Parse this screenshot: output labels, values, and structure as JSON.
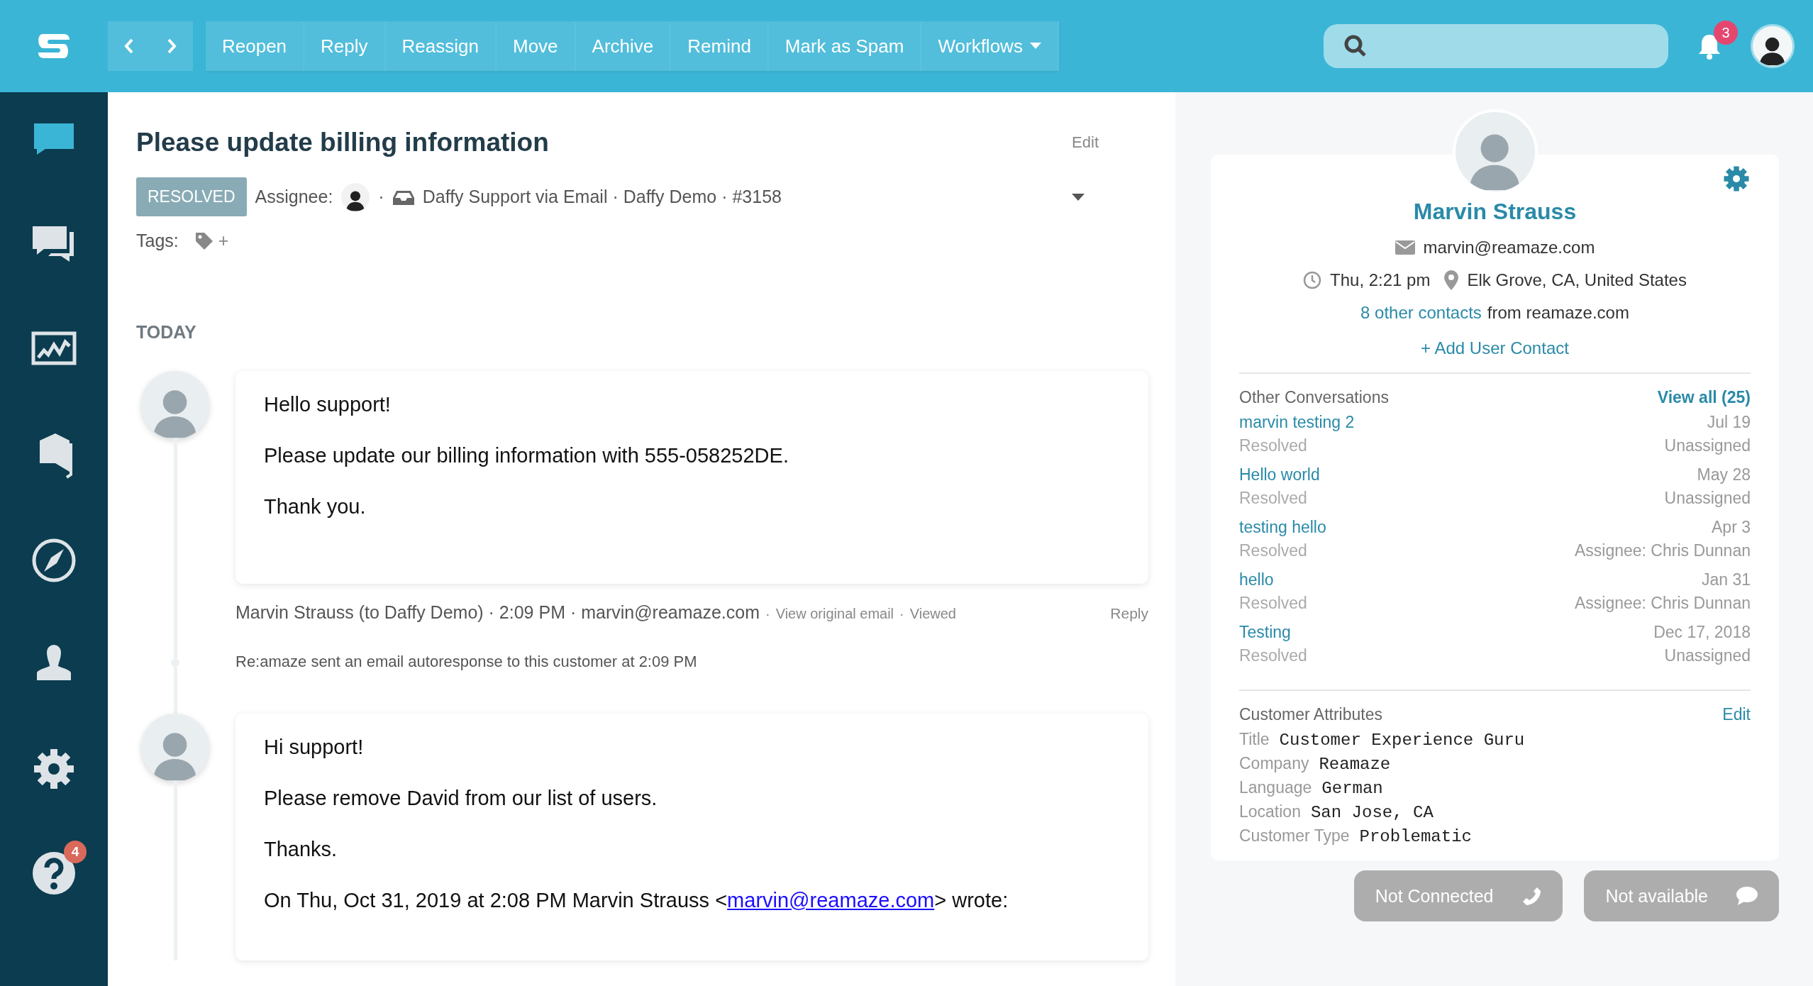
{
  "topbar": {
    "actions": [
      {
        "label": "Reopen",
        "kind": "button"
      },
      {
        "label": "Reply",
        "kind": "button"
      },
      {
        "label": "Reassign",
        "kind": "button"
      },
      {
        "label": "Move",
        "kind": "button"
      },
      {
        "label": "Archive",
        "kind": "button"
      },
      {
        "label": "Remind",
        "kind": "button"
      },
      {
        "label": "Mark as Spam",
        "kind": "button"
      },
      {
        "label": "Workflows",
        "kind": "dropdown"
      }
    ],
    "notification_count": "3"
  },
  "sidebar": {
    "items": [
      {
        "kind": "chat",
        "selected": true
      },
      {
        "kind": "chats",
        "selected": false
      },
      {
        "kind": "chart",
        "selected": false
      },
      {
        "kind": "book",
        "selected": false
      },
      {
        "kind": "compass",
        "selected": false
      },
      {
        "kind": "user",
        "selected": false
      },
      {
        "kind": "gear",
        "selected": false
      },
      {
        "kind": "help",
        "selected": false,
        "badge": "4"
      }
    ]
  },
  "conversation": {
    "title": "Please update billing information",
    "edit": "Edit",
    "status": "RESOLVED",
    "assignee_label": "Assignee:",
    "separator": "·",
    "channel": "Daffy Support via Email · Daffy Demo · #3158",
    "tags_label": "Tags:",
    "add_tag": "+",
    "date_heading": "TODAY",
    "entries": [
      {
        "kind": "message",
        "paragraphs": [
          {
            "kind": "text",
            "text": "Hello support!"
          },
          {
            "kind": "text",
            "text": "Please update our billing information with 555-058252DE."
          },
          {
            "kind": "text",
            "text": "Thank you."
          }
        ],
        "meta": "Marvin Strauss (to Daffy Demo) · 2:09 PM · marvin@reamaze.com",
        "meta_links": [
          {
            "separator": "·",
            "label": "View original email"
          },
          {
            "separator": "·",
            "label": "Viewed"
          }
        ],
        "reply": "Reply"
      },
      {
        "kind": "note",
        "text": "Re:amaze sent an email autoresponse to this customer at 2:09 PM"
      },
      {
        "kind": "message",
        "paragraphs": [
          {
            "kind": "text",
            "text": "Hi support!"
          },
          {
            "kind": "text",
            "text": "Please remove David from our list of users."
          },
          {
            "kind": "text",
            "text": "Thanks."
          },
          {
            "kind": "quote",
            "before": "On Thu, Oct 31, 2019 at 2:08 PM Marvin Strauss <",
            "link": "marvin@reamaze.com",
            "after": "> wrote:"
          }
        ]
      }
    ]
  },
  "customer": {
    "name": "Marvin Strauss",
    "email": "marvin@reamaze.com",
    "local_time": "Thu, 2:21 pm",
    "location": "Elk Grove, CA, United States",
    "contacts_link": "8 other contacts",
    "contacts_suffix": "from reamaze.com",
    "add_contact": "+ Add User Contact",
    "other_conversations": {
      "heading": "Other Conversations",
      "view_all": "View all (25)",
      "items": [
        {
          "title": "marvin testing 2",
          "date": "Jul 19",
          "status": "Resolved",
          "assignee": "Unassigned"
        },
        {
          "title": "Hello world",
          "date": "May 28",
          "status": "Resolved",
          "assignee": "Unassigned"
        },
        {
          "title": "testing hello",
          "date": "Apr 3",
          "status": "Resolved",
          "assignee": "Assignee: Chris Dunnan"
        },
        {
          "title": "hello",
          "date": "Jan 31",
          "status": "Resolved",
          "assignee": "Assignee: Chris Dunnan"
        },
        {
          "title": "Testing",
          "date": "Dec 17, 2018",
          "status": "Resolved",
          "assignee": "Unassigned"
        }
      ]
    },
    "attributes": {
      "heading": "Customer Attributes",
      "edit": "Edit",
      "items": [
        {
          "label": "Title",
          "value": "Customer Experience Guru"
        },
        {
          "label": "Company",
          "value": "Reamaze"
        },
        {
          "label": "Language",
          "value": "German"
        },
        {
          "label": "Location",
          "value": "San Jose, CA"
        },
        {
          "label": "Customer Type",
          "value": "Problematic"
        }
      ]
    }
  },
  "status_buttons": [
    {
      "kind": "phone",
      "label": "Not Connected"
    },
    {
      "kind": "chat",
      "label": "Not available"
    }
  ]
}
